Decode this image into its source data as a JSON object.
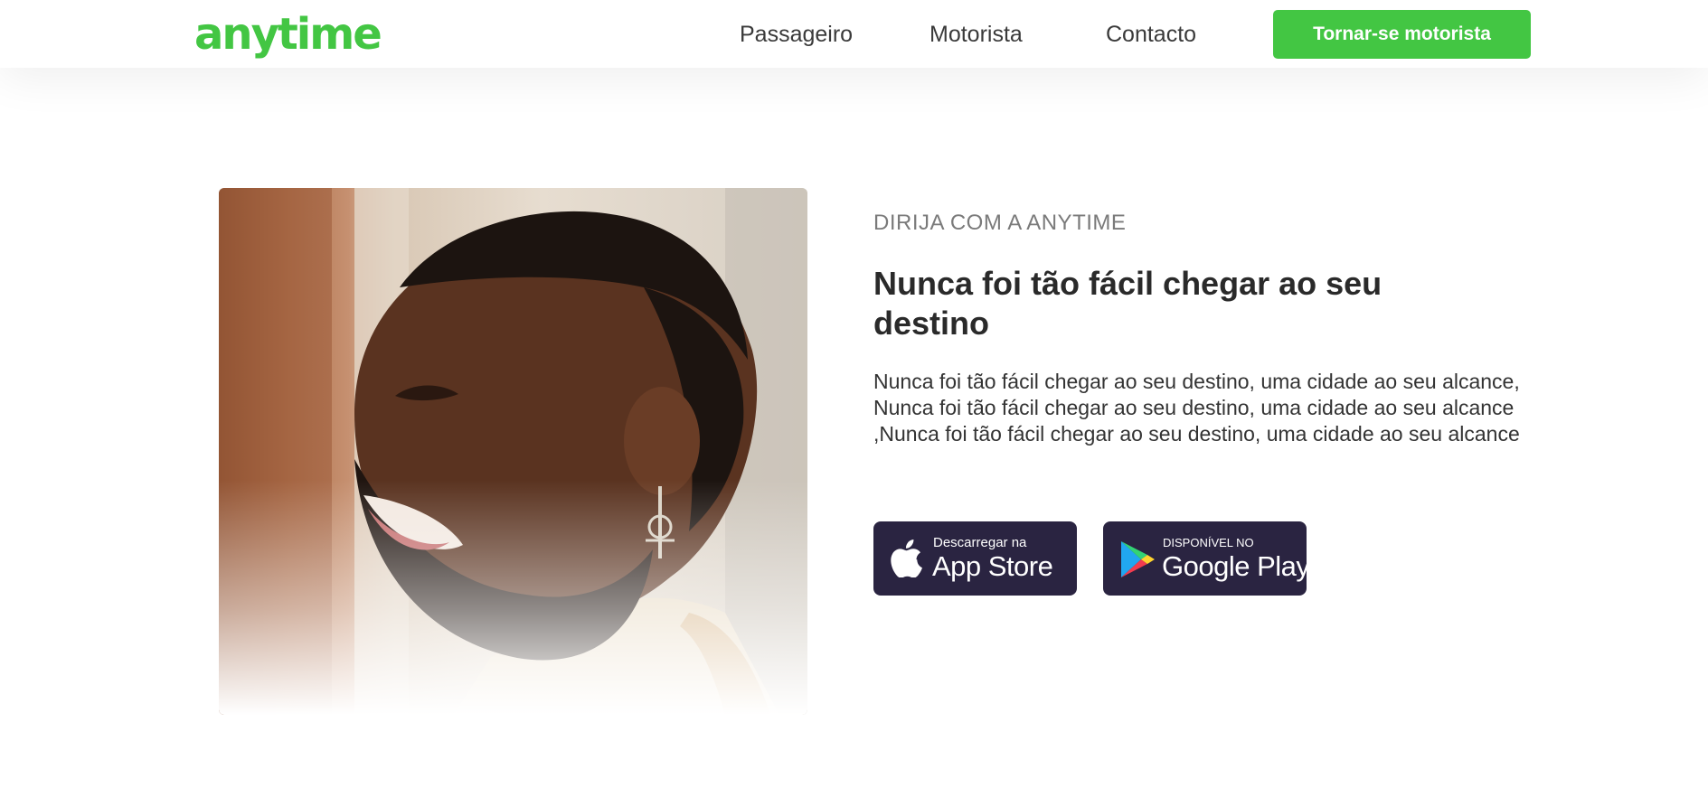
{
  "header": {
    "logo": "anytime",
    "nav": [
      "Passageiro",
      "Motorista",
      "Contacto"
    ],
    "cta_label": "Tornar-se motorista"
  },
  "hero": {
    "eyebrow": "DIRIJA COM A ANYTIME",
    "title": "Nunca foi tão fácil chegar ao seu destino",
    "description": "Nunca foi tão fácil chegar ao seu destino, uma cidade ao seu alcance, Nunca foi tão fácil chegar ao seu destino, uma cidade ao seu alcance ,Nunca foi tão fácil chegar ao seu destino, uma cidade ao seu alcance",
    "image_icon": "photo-smiling-man"
  },
  "stores": {
    "apple": {
      "small": "Descarregar na",
      "big": "App Store",
      "icon": "apple-icon"
    },
    "google": {
      "small": "DISPONÍVEL NO",
      "big": "Google Play",
      "icon": "google-play-icon"
    }
  },
  "colors": {
    "brand_green": "#43c643",
    "store_badge": "#2a2441",
    "text_dark": "#2a2a2a",
    "text_muted": "#7a7a7a"
  }
}
